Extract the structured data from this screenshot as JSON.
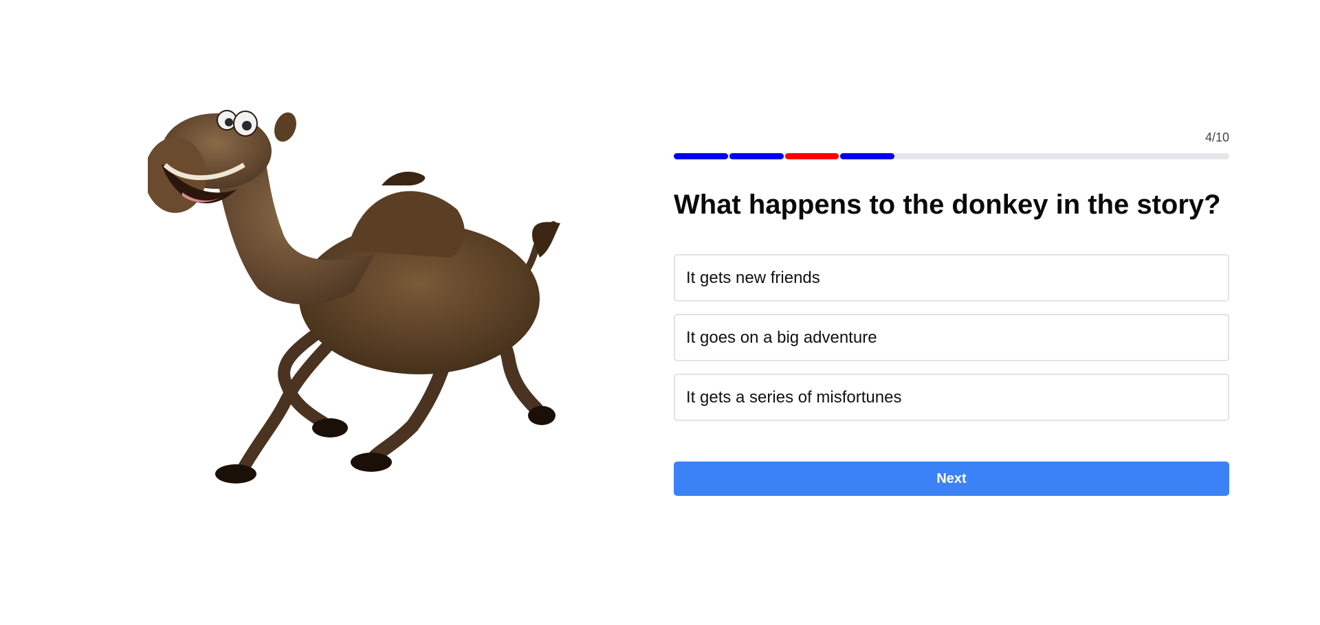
{
  "progress": {
    "counter": "4/10",
    "current": 4,
    "total": 10,
    "answered": [
      {
        "status": "correct",
        "color": "#0000ee"
      },
      {
        "status": "correct",
        "color": "#0000ee"
      },
      {
        "status": "incorrect",
        "color": "#ff0000"
      },
      {
        "status": "correct",
        "color": "#0000ee"
      }
    ],
    "track_color": "#e5e7eb"
  },
  "illustration": {
    "icon": "camel-illustration"
  },
  "question": {
    "text": "What happens to the donkey in the story?"
  },
  "options": [
    {
      "label": "It gets new friends"
    },
    {
      "label": "It goes on a big adventure"
    },
    {
      "label": "It gets a series of misfortunes"
    }
  ],
  "next_button": {
    "label": "Next",
    "color": "#3b82f6"
  }
}
